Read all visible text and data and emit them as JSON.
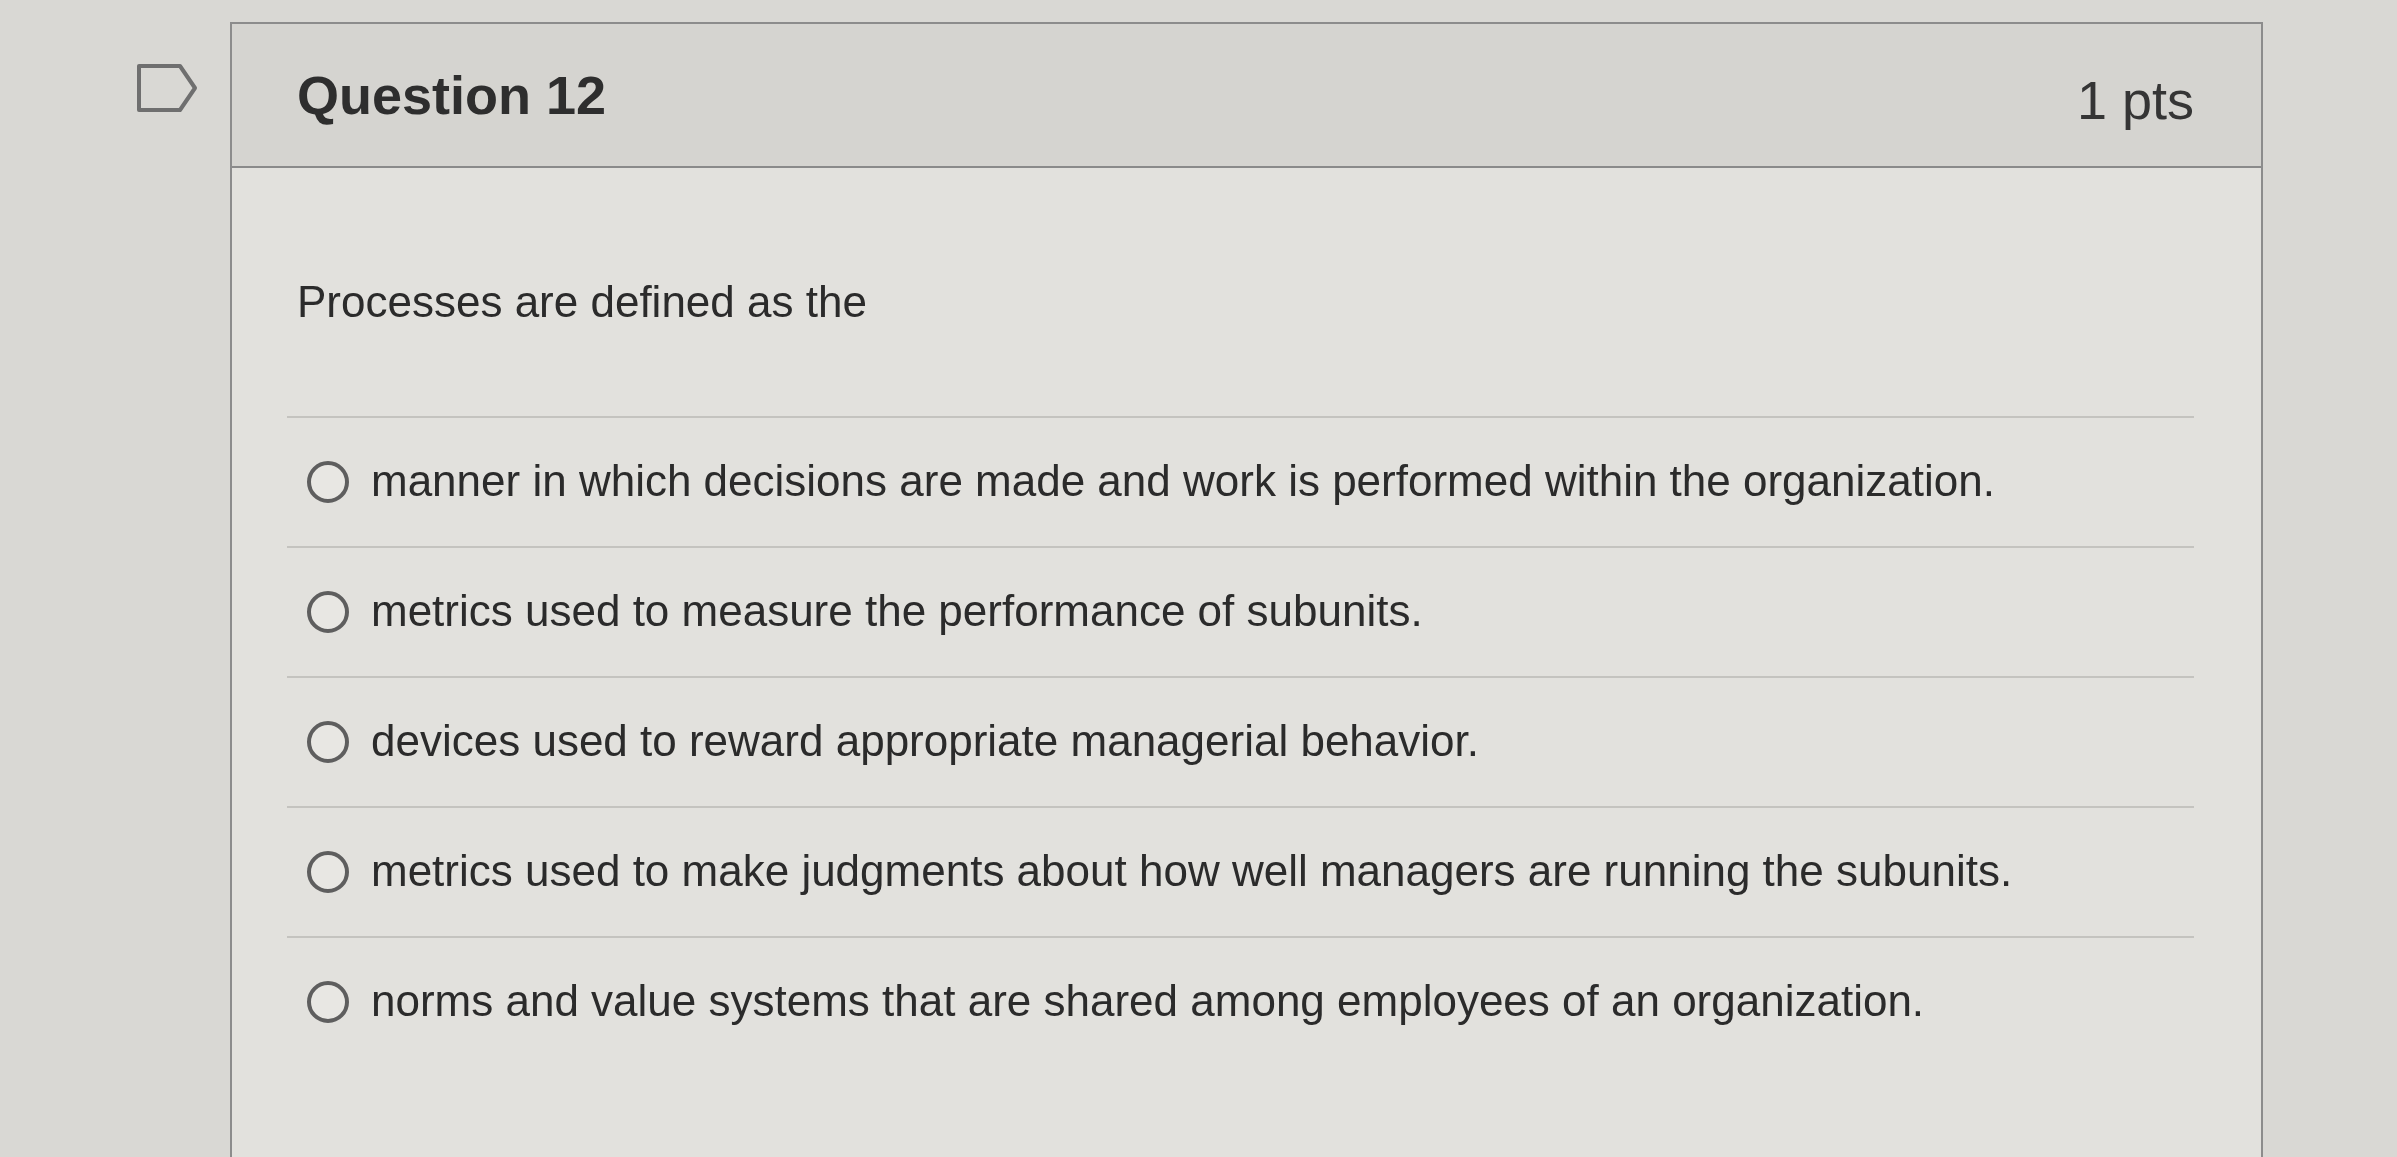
{
  "question": {
    "title": "Question 12",
    "points": "1 pts",
    "flagged": false,
    "prompt": "Processes are defined as the",
    "options": [
      {
        "label": "manner in which decisions are made and work is performed within the organization.",
        "selected": false
      },
      {
        "label": "metrics used to measure the performance of subunits.",
        "selected": false
      },
      {
        "label": "devices used to reward appropriate managerial behavior.",
        "selected": false
      },
      {
        "label": "metrics used to make judgments about how well managers are running the subunits.",
        "selected": false
      },
      {
        "label": "norms and value systems that are shared among employees of an organization.",
        "selected": false
      }
    ]
  }
}
